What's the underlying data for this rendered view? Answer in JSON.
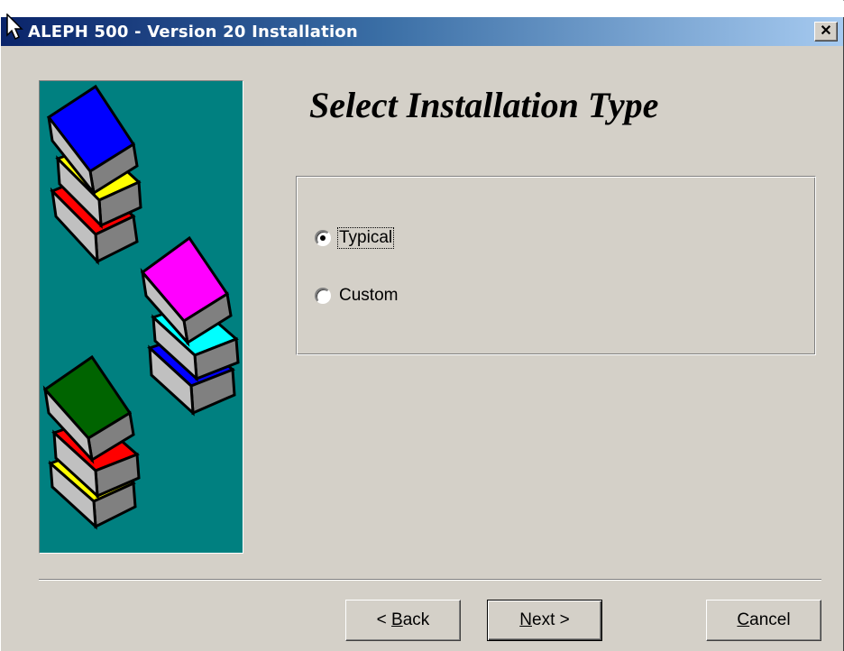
{
  "window": {
    "title": "ALEPH 500 - Version 20 Installation",
    "close_glyph": "✕"
  },
  "main": {
    "heading": "Select Installation Type"
  },
  "options": [
    {
      "label": "Typical",
      "selected": true
    },
    {
      "label": "Custom",
      "selected": false
    }
  ],
  "buttons": {
    "back": {
      "prefix": "< ",
      "mnemonic": "B",
      "rest": "ack"
    },
    "next": {
      "prefix": "",
      "mnemonic": "N",
      "rest": "ext >"
    },
    "cancel": {
      "prefix": "",
      "mnemonic": "C",
      "rest": "ancel"
    }
  },
  "icons": {
    "banner": "stacked-books-illustration",
    "cursor": "arrow-cursor-icon"
  },
  "colors": {
    "title_start": "#0a246a",
    "title_end": "#a6caf0",
    "banner_bg": "#008080",
    "dialog_bg": "#d4d0c8"
  }
}
